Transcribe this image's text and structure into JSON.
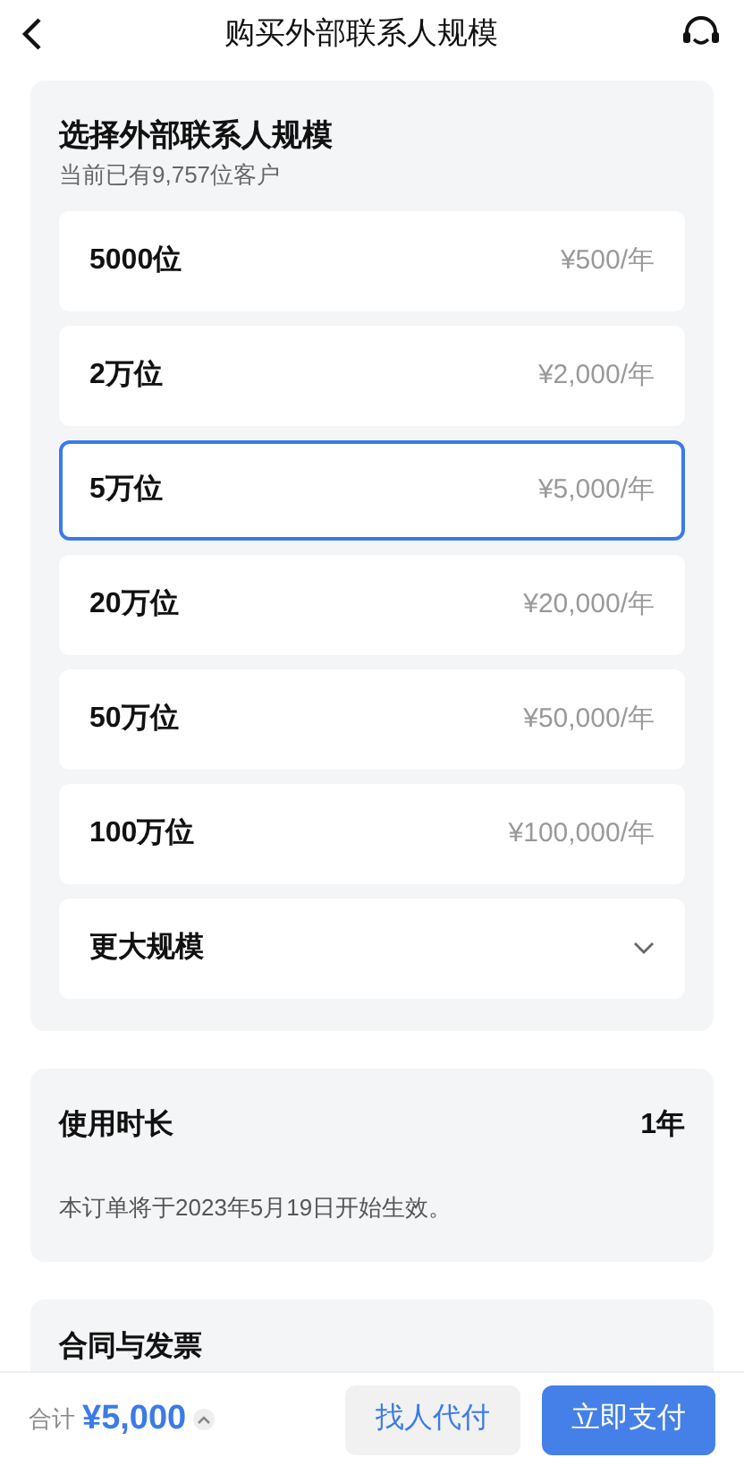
{
  "header": {
    "title": "购买外部联系人规模"
  },
  "scale": {
    "title": "选择外部联系人规模",
    "subtitle": "当前已有9,757位客户",
    "options": [
      {
        "kind": "plan",
        "label": "5000位",
        "price": "¥500/年",
        "selected": false
      },
      {
        "kind": "plan",
        "label": "2万位",
        "price": "¥2,000/年",
        "selected": false
      },
      {
        "kind": "plan",
        "label": "5万位",
        "price": "¥5,000/年",
        "selected": true
      },
      {
        "kind": "plan",
        "label": "20万位",
        "price": "¥20,000/年",
        "selected": false
      },
      {
        "kind": "plan",
        "label": "50万位",
        "price": "¥50,000/年",
        "selected": false
      },
      {
        "kind": "plan",
        "label": "100万位",
        "price": "¥100,000/年",
        "selected": false
      },
      {
        "kind": "more",
        "label": "更大规模",
        "selected": false
      }
    ]
  },
  "duration": {
    "label": "使用时长",
    "value": "1年",
    "note": "本订单将于2023年5月19日开始生效。"
  },
  "contract": {
    "title": "合同与发票"
  },
  "footer": {
    "total_label": "合计",
    "total": "¥5,000",
    "secondary_button": "找人代付",
    "primary_button": "立即支付"
  }
}
